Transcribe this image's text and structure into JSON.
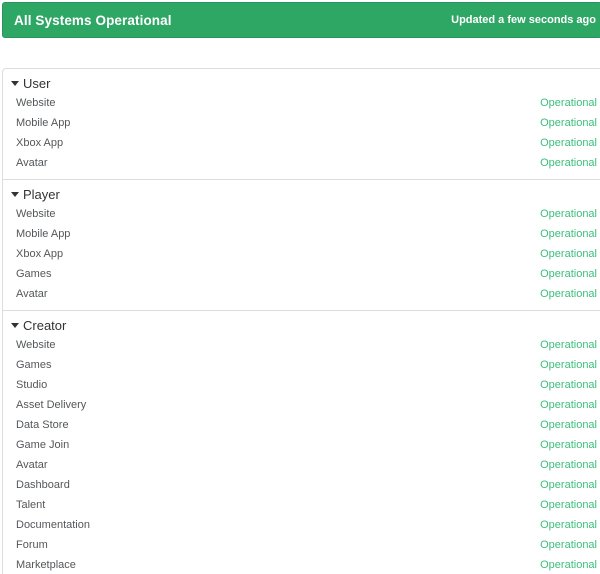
{
  "banner": {
    "title": "All Systems Operational",
    "updated": "Updated a few seconds ago",
    "bg_color": "#2EA664",
    "border_color": "#28955A",
    "text_color": "#FFFFFF"
  },
  "status_colors": {
    "operational": "#3CBE7C"
  },
  "icons": {
    "section_collapse": "triangle-down"
  },
  "sections": [
    {
      "name": "User",
      "components": [
        {
          "label": "Website",
          "status": "Operational"
        },
        {
          "label": "Mobile App",
          "status": "Operational"
        },
        {
          "label": "Xbox App",
          "status": "Operational"
        },
        {
          "label": "Avatar",
          "status": "Operational"
        }
      ]
    },
    {
      "name": "Player",
      "components": [
        {
          "label": "Website",
          "status": "Operational"
        },
        {
          "label": "Mobile App",
          "status": "Operational"
        },
        {
          "label": "Xbox App",
          "status": "Operational"
        },
        {
          "label": "Games",
          "status": "Operational"
        },
        {
          "label": "Avatar",
          "status": "Operational"
        }
      ]
    },
    {
      "name": "Creator",
      "components": [
        {
          "label": "Website",
          "status": "Operational"
        },
        {
          "label": "Games",
          "status": "Operational"
        },
        {
          "label": "Studio",
          "status": "Operational"
        },
        {
          "label": "Asset Delivery",
          "status": "Operational"
        },
        {
          "label": "Data Store",
          "status": "Operational"
        },
        {
          "label": "Game Join",
          "status": "Operational"
        },
        {
          "label": "Avatar",
          "status": "Operational"
        },
        {
          "label": "Dashboard",
          "status": "Operational"
        },
        {
          "label": "Talent",
          "status": "Operational"
        },
        {
          "label": "Documentation",
          "status": "Operational"
        },
        {
          "label": "Forum",
          "status": "Operational"
        },
        {
          "label": "Marketplace",
          "status": "Operational"
        }
      ]
    }
  ]
}
